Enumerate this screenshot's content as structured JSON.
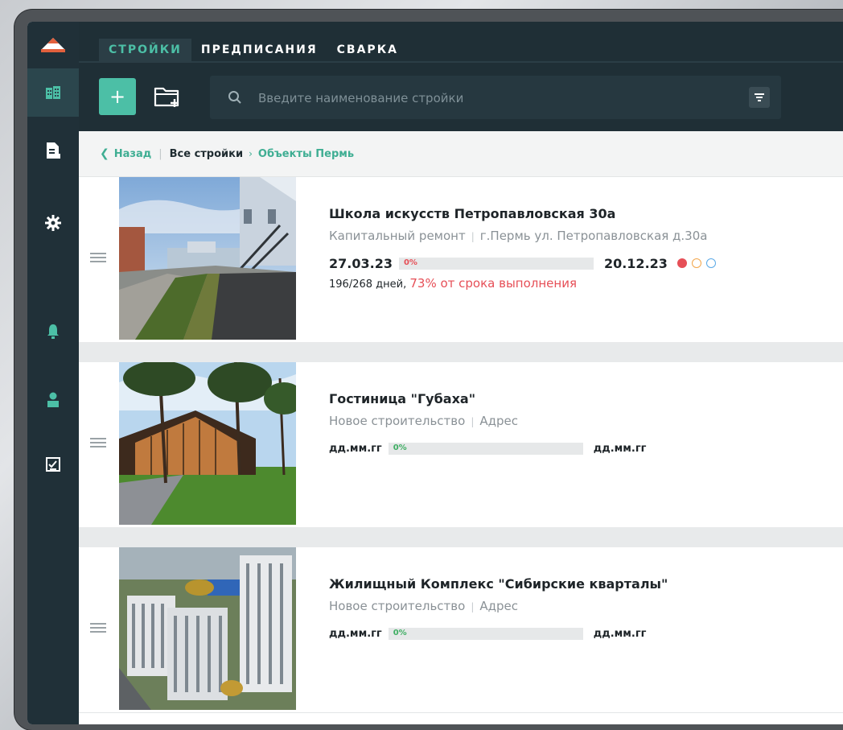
{
  "header": {
    "tabs": [
      {
        "label": "СТРОЙКИ",
        "active": true
      },
      {
        "label": "ПРЕДПИСАНИЯ",
        "active": false
      },
      {
        "label": "СВАРКА",
        "active": false
      }
    ],
    "add_label": "+",
    "search": {
      "placeholder": "Введите наименование стройки",
      "value": ""
    }
  },
  "sidebar": {
    "items": [
      {
        "icon": "buildings-icon",
        "active": true
      },
      {
        "icon": "document-icon",
        "active": false
      },
      {
        "icon": "gear-icon",
        "active": false
      },
      {
        "icon": "bell-icon",
        "active": false
      },
      {
        "icon": "user-icon",
        "active": false
      },
      {
        "icon": "checklist-icon",
        "active": false
      }
    ]
  },
  "breadcrumb": {
    "back": "Назад",
    "current": "Все стройки",
    "link": "Объекты Пермь"
  },
  "projects": [
    {
      "title": "Школа искусств Петропавловская 30а",
      "type": "Капитальный ремонт",
      "address": "г.Пермь ул. Петропавловская д.30а",
      "start": "27.03.23",
      "end": "20.12.23",
      "progress_label": "0%",
      "progress": 0,
      "progress_color": "#e64f57",
      "days": "196/268 дней,",
      "deadline_text": "73% от срока выполнения",
      "status_dots": [
        "#e64f57",
        "#f3a64a",
        "#5aa9e6"
      ]
    },
    {
      "title": "Гостиница \"Губаха\"",
      "type": "Новое строительство",
      "address": "Адрес",
      "start": "дд.мм.гг",
      "end": "дд.мм.гг",
      "progress_label": "0%",
      "progress": 0,
      "progress_color": "#3fae63"
    },
    {
      "title": "Жилищный Комплекс \"Сибирские кварталы\"",
      "type": "Новое строительство",
      "address": "Адрес",
      "start": "дд.мм.гг",
      "end": "дд.мм.гг",
      "progress_label": "0%",
      "progress": 0,
      "progress_color": "#3fae63"
    }
  ],
  "colors": {
    "accent": "#4cbfa6",
    "sidebar": "#203038",
    "danger": "#e64f57"
  }
}
